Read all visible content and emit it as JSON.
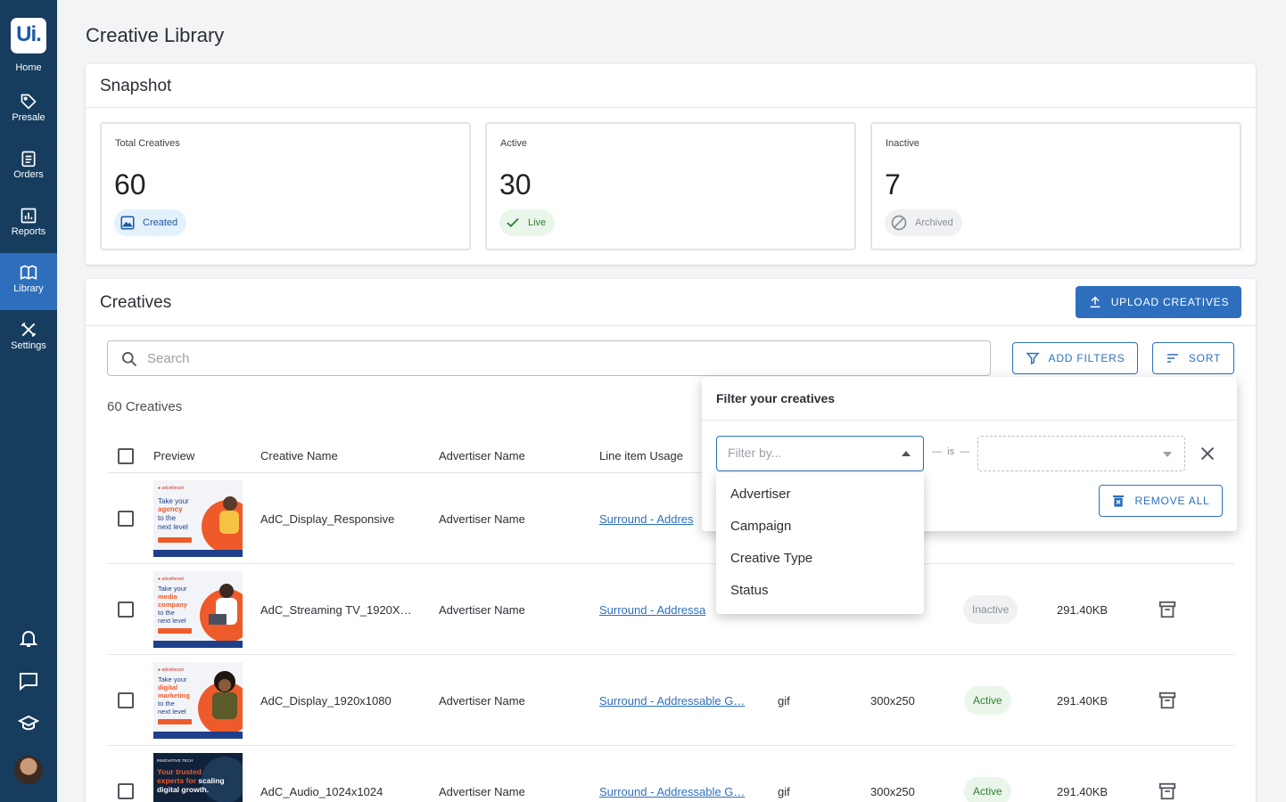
{
  "sidebar": {
    "logo": "Ui.",
    "items": [
      {
        "label": "Home",
        "icon": "home-logo"
      },
      {
        "label": "Presale",
        "icon": "tag-icon"
      },
      {
        "label": "Orders",
        "icon": "clipboard-icon"
      },
      {
        "label": "Reports",
        "icon": "bar-chart-icon"
      },
      {
        "label": "Library",
        "icon": "book-icon",
        "active": true
      },
      {
        "label": "Settings",
        "icon": "tools-icon"
      }
    ],
    "bottom_icons": [
      "bell-icon",
      "chat-icon",
      "graduation-cap-icon",
      "avatar"
    ]
  },
  "page": {
    "title": "Creative Library"
  },
  "snapshot": {
    "title": "Snapshot",
    "cards": [
      {
        "label": "Total Creatives",
        "value": "60",
        "chip": "Created",
        "chip_icon": "image-icon"
      },
      {
        "label": "Active",
        "value": "30",
        "chip": "Live",
        "chip_icon": "check-icon"
      },
      {
        "label": "Inactive",
        "value": "7",
        "chip": "Archived",
        "chip_icon": "block-icon"
      }
    ]
  },
  "creatives": {
    "title": "Creatives",
    "upload_label": "UPLOAD CREATIVES",
    "search_placeholder": "Search",
    "add_filters_label": "ADD FILTERS",
    "sort_label": "SORT",
    "count_label": "60 Creatives",
    "columns": {
      "preview": "Preview",
      "name": "Creative Name",
      "advertiser": "Advertiser Name",
      "line_item": "Line item Usage"
    },
    "rows": [
      {
        "name": "AdC_Display_Responsive",
        "advertiser": "Advertiser Name",
        "line_item": "Surround - Addres",
        "type": "",
        "size": "",
        "status": "",
        "file_size": "",
        "thumb": {
          "head1": "Take your",
          "hl": "agency",
          "tail": [
            "to the",
            "next level"
          ]
        }
      },
      {
        "name": "AdC_Streaming TV_1920X…",
        "advertiser": "Advertiser Name",
        "line_item": "Surround - Addressa",
        "type": "",
        "size": "",
        "status": "Inactive",
        "file_size": "291.40KB",
        "thumb": {
          "head1": "Take your",
          "hl": "media company",
          "tail": [
            "to the",
            "next level"
          ]
        }
      },
      {
        "name": "AdC_Display_1920x1080",
        "advertiser": "Advertiser Name",
        "line_item": "Surround - Addressable G…",
        "type": "gif",
        "size": "300x250",
        "status": "Active",
        "file_size": "291.40KB",
        "thumb": {
          "head1": "Take your",
          "hl": "digital marketing",
          "tail": [
            "to the",
            "next level"
          ]
        }
      },
      {
        "name": "AdC_Audio_1024x1024",
        "advertiser": "Advertiser Name",
        "line_item": "Surround - Addressable G…",
        "type": "gif",
        "size": "300x250",
        "status": "Active",
        "file_size": "291.40KB",
        "thumb": {
          "head1": "INNOVATIVE TECH",
          "hl": "Your trusted experts for scaling",
          "tail": [
            "digital growth."
          ]
        }
      }
    ]
  },
  "filter_popover": {
    "title": "Filter your creatives",
    "filter_placeholder": "Filter by...",
    "operator": "is",
    "remove_all_label": "REMOVE ALL",
    "options": [
      "Advertiser",
      "Campaign",
      "Creative Type",
      "Status"
    ]
  },
  "colors": {
    "sidebar": "#163c5e",
    "accent": "#2d6fbd",
    "active_green": "#2f7d32"
  }
}
